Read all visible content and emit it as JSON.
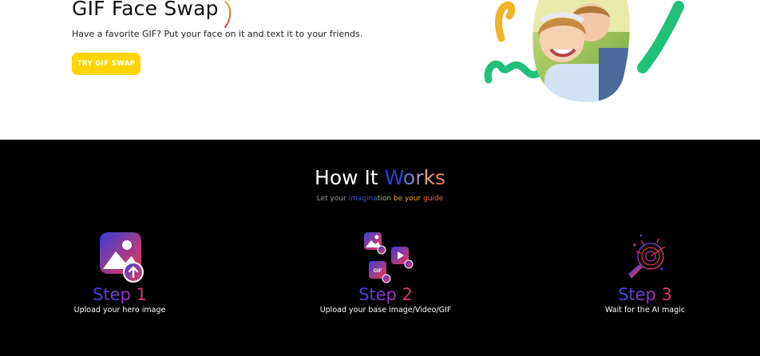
{
  "hero": {
    "title": "GIF Face Swap",
    "subtitle": "Have a favorite GIF? Put your face on it and text it to your friends.",
    "button_label": "TRY GIF SWAP"
  },
  "how": {
    "title_part1": "How It ",
    "title_part2": "W",
    "title_part3": "orks",
    "sub_part1": "Let your ",
    "sub_part2": "imagina",
    "sub_part3": "tion ",
    "sub_part4": "be your ",
    "sub_part5": "guide",
    "steps": [
      {
        "title": "Step 1",
        "desc": "Upload your hero image"
      },
      {
        "title": "Step 2",
        "desc": "Upload your base image/Video/GIF"
      },
      {
        "title": "Step 3",
        "desc": "Wait for the AI magic"
      }
    ],
    "gif_badge": "GIF"
  },
  "colors": {
    "button": "#ffd400",
    "dark_bg": "#000000",
    "step_gradient_start": "#3a3fd8",
    "step_gradient_end": "#f0374f"
  }
}
